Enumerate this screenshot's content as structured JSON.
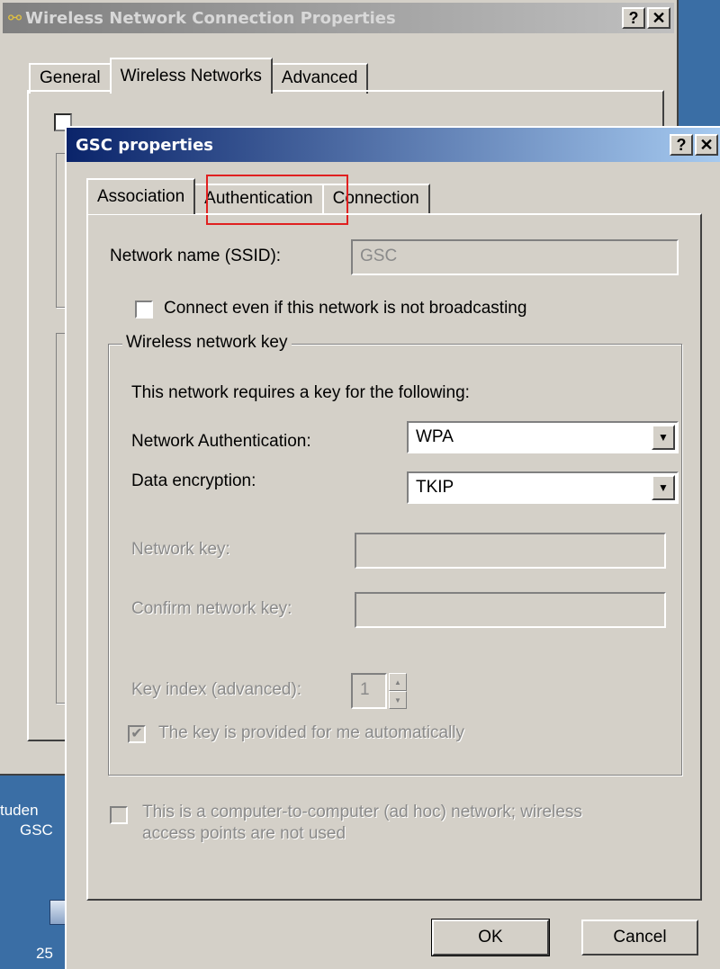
{
  "desktop": {
    "label_line1": "tuden",
    "label_line2": "GSC",
    "number": "25",
    "icon": "network-config-icon"
  },
  "back_window": {
    "title": "Wireless Network Connection Properties",
    "title_icon": "network-connection-icon",
    "help_btn": "?",
    "close_btn": "✕",
    "tabs": [
      "General",
      "Wireless Networks",
      "Advanced"
    ]
  },
  "dialog": {
    "title": "GSC properties",
    "help_btn": "?",
    "close_btn": "✕",
    "tabs": [
      "Association",
      "Authentication",
      "Connection"
    ],
    "ssid_label": "Network name (SSID):",
    "ssid_value": "GSC",
    "broadcast_label": "Connect even if this network is not broadcasting",
    "group_title": "Wireless network key",
    "requires_text": "This network requires a key for the following:",
    "auth_label": "Network Authentication:",
    "auth_value": "WPA",
    "enc_label": "Data encryption:",
    "enc_value": "TKIP",
    "netkey_label": "Network key:",
    "confirm_label": "Confirm network key:",
    "keyindex_label": "Key index (advanced):",
    "keyindex_value": "1",
    "auto_label": "The key is provided for me automatically",
    "adhoc_line1": "This is a computer-to-computer (ad hoc) network; wireless",
    "adhoc_line2": "access points are not used",
    "ok_label": "OK",
    "cancel_label": "Cancel",
    "highlight_color": "#e02020"
  }
}
